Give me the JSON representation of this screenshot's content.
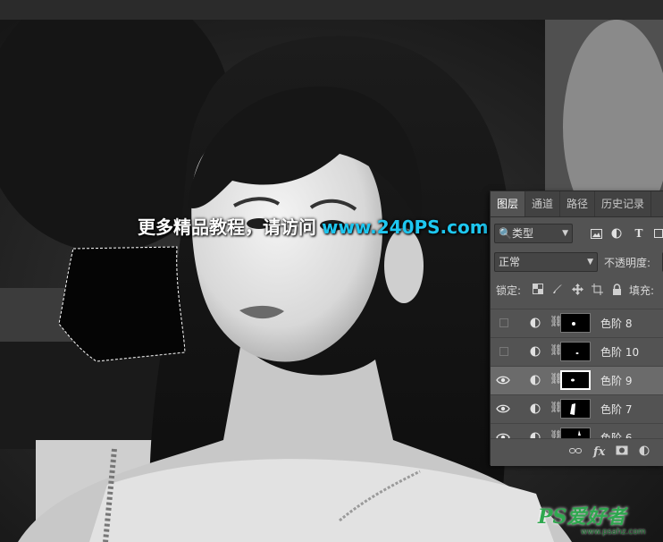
{
  "watermark": {
    "text_cn": "更多精品教程，请访问",
    "url": "www.240PS.com"
  },
  "logo": {
    "brand": "PS爱好者",
    "url": "www.psahz.com"
  },
  "layers_panel": {
    "tabs": [
      {
        "label": "图层",
        "active": true
      },
      {
        "label": "通道",
        "active": false
      },
      {
        "label": "路径",
        "active": false
      },
      {
        "label": "历史记录",
        "active": false
      }
    ],
    "filter": {
      "kind_value": "类型"
    },
    "blend_mode": "正常",
    "opacity_label": "不透明度:",
    "lock_label": "锁定:",
    "fill_label": "填充:",
    "layers": [
      {
        "name": "色阶 8",
        "visible": false,
        "selected": false
      },
      {
        "name": "色阶 10",
        "visible": false,
        "selected": false
      },
      {
        "name": "色阶 9",
        "visible": true,
        "selected": true
      },
      {
        "name": "色阶 7",
        "visible": true,
        "selected": false
      },
      {
        "name": "色阶 6",
        "visible": true,
        "selected": false
      }
    ]
  },
  "colors": {
    "panel_bg": "#535353",
    "selected_row": "#6b6b6b",
    "url_accent": "#1ec7f0",
    "logo_green": "#2fa84f"
  }
}
